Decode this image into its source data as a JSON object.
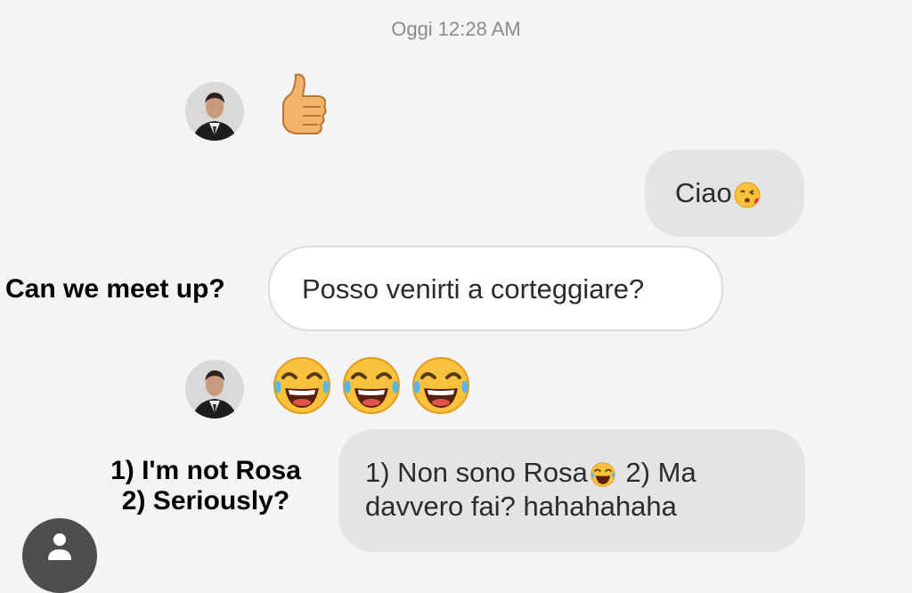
{
  "header": {
    "timestamp": "Oggi 12:28 AM"
  },
  "messages": [
    {
      "sender": "other",
      "content_emoji": [
        "thumbs-up"
      ]
    },
    {
      "sender": "me",
      "text": "Ciao",
      "emoji": "kissing-face"
    },
    {
      "sender": "other",
      "text": "Posso venirti a corteggiare?"
    },
    {
      "sender": "other",
      "content_emoji": [
        "tears-of-joy",
        "tears-of-joy",
        "tears-of-joy"
      ]
    },
    {
      "sender": "me",
      "text_a": "1) Non sono Rosa",
      "text_b": "2) Ma davvero fai? hahahahaha",
      "emoji": "tears-of-joy"
    }
  ],
  "overlay_captions": {
    "meet_up": "Can we meet up?",
    "rosa_line1": "1) I'm not Rosa",
    "rosa_line2": "2) Seriously?"
  },
  "colors": {
    "background": "#f4f4f4",
    "incoming_bubble": "#ffffff",
    "outgoing_bubble": "#e4e4e4",
    "timestamp_text": "#8c8c8c",
    "fab": "#4e4e4e"
  },
  "icons": [
    "thumbs-up-icon",
    "tears-of-joy-icon",
    "kissing-face-icon",
    "user-icon"
  ]
}
